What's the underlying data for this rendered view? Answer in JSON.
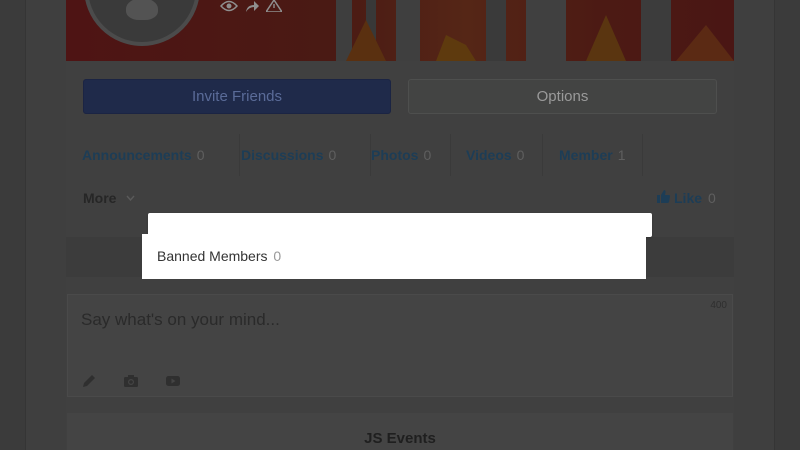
{
  "group": {
    "cover_colors": {
      "base": "#4a1414",
      "accent": "#5a2a18"
    }
  },
  "actions": {
    "invite_label": "Invite Friends",
    "options_label": "Options"
  },
  "tabs": [
    {
      "label": "Announcements",
      "count": "0"
    },
    {
      "label": "Discussions",
      "count": "0"
    },
    {
      "label": "Photos",
      "count": "0"
    },
    {
      "label": "Videos",
      "count": "0"
    },
    {
      "label": "Member",
      "count": "1"
    }
  ],
  "more": {
    "label": "More"
  },
  "like": {
    "label": "Like",
    "count": "0"
  },
  "dropdown": {
    "items": [
      {
        "label": "Banned Members",
        "count": "0"
      }
    ]
  },
  "composer": {
    "placeholder": "Say what's on your mind...",
    "char_limit": "400",
    "tools": [
      "pencil-icon",
      "camera-icon",
      "video-icon"
    ]
  },
  "events": {
    "title": "JS Events"
  }
}
